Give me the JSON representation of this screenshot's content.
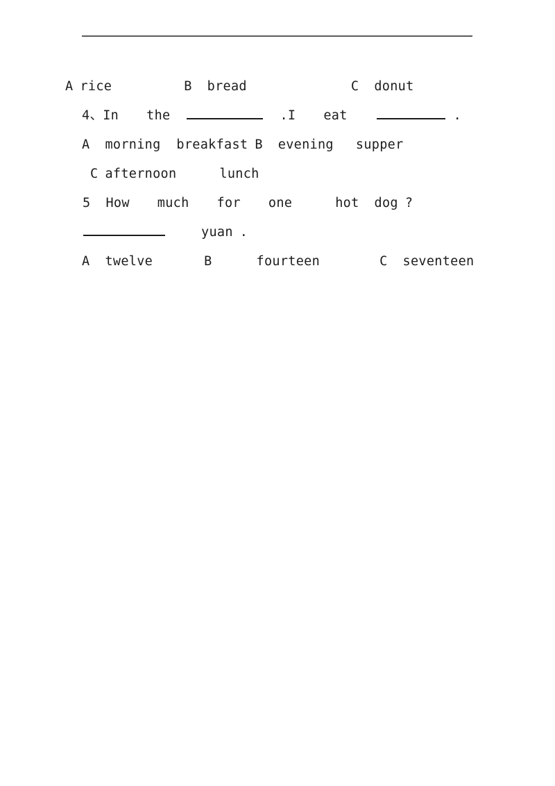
{
  "document": {
    "page_background": "#ffffff",
    "text_color": "#1d1d1d",
    "rule_color": "#5a5a5a",
    "blank_color": "#1b1b1b",
    "divider": {
      "name": "horizontal-rule"
    },
    "lines": [
      {
        "id": "q3-options",
        "tokens": {
          "a_label": "A",
          "a_text": "rice",
          "b_label": "B",
          "b_text": "bread",
          "c_label": "C",
          "c_text": "donut"
        }
      },
      {
        "id": "q4-stem",
        "tokens": {
          "number": "4、In",
          "the": "the",
          "period_i": ".I",
          "eat": "eat",
          "final_period": "."
        }
      },
      {
        "id": "q4-options-ab",
        "tokens": {
          "a_label": "A",
          "a_text": "morning  breakfast",
          "b_label": "B",
          "b_text": "evening",
          "b_text2": "supper"
        }
      },
      {
        "id": "q4-options-c",
        "tokens": {
          "c_label": "C",
          "c_text": "afternoon",
          "c_text2": "lunch"
        }
      },
      {
        "id": "q5-stem",
        "tokens": {
          "number": "5",
          "how": "How",
          "much": "much",
          "for": "for",
          "one": "one",
          "hot": "hot",
          "dog": "dog",
          "question_mark": "?"
        }
      },
      {
        "id": "q5-answer-line",
        "tokens": {
          "unit": "yuan",
          "period": "."
        }
      },
      {
        "id": "q5-options",
        "tokens": {
          "a_label": "A",
          "a_text": "twelve",
          "b_label": "B",
          "b_text": "fourteen",
          "c_label": "C",
          "c_text": "seventeen"
        }
      }
    ]
  }
}
